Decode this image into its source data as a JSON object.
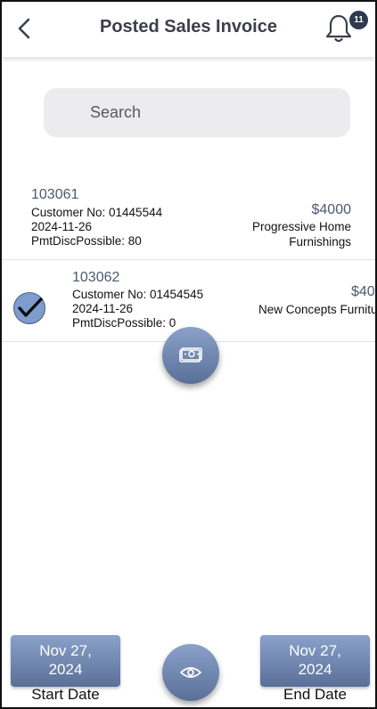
{
  "header": {
    "title": "Posted Sales Invoice",
    "back_icon": "chevron-left-icon",
    "bell_icon": "bell-icon",
    "notification_count": "11"
  },
  "search": {
    "placeholder": "Search",
    "value": ""
  },
  "invoices": [
    {
      "id": "103061",
      "customer": "Customer No: 01445544",
      "date": "2024-11-26",
      "discount": "PmtDiscPossible: 80",
      "amount": "$4000",
      "customer_name_line1": "Progressive Home",
      "customer_name_line2": "Furnishings",
      "selected": false
    },
    {
      "id": "103062",
      "customer": "Customer No: 01454545",
      "date": "2024-11-26",
      "discount": "PmtDiscPossible: 0",
      "amount": "$40",
      "customer_name_line1": "New Concepts Furnitu",
      "selected": true
    }
  ],
  "actions": {
    "pay_icon": "cash-icon",
    "view_icon": "eye-icon"
  },
  "dates": {
    "start_line1": "Nov 27,",
    "start_line2": "2024",
    "start_label": "Start Date",
    "end_line1": "Nov 27,",
    "end_line2": "2024",
    "end_label": "End Date"
  },
  "colors": {
    "accent": "#6f87b3",
    "checkbox": "#7e9ccc",
    "badge": "#2f3a4f",
    "title": "#3b3f4a"
  }
}
